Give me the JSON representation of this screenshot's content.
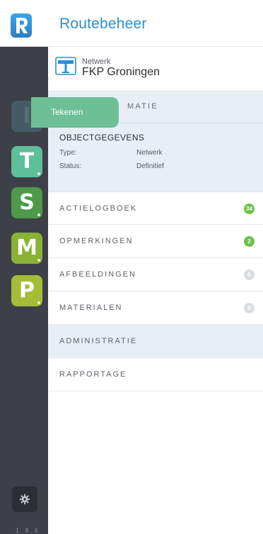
{
  "header": {
    "logo_letter": "R",
    "title": "Routebeheer"
  },
  "rail": {
    "modules": [
      {
        "letter": "I",
        "color": "#4d7482",
        "state": "disabled"
      },
      {
        "letter": "T",
        "color": "#5fbf9a",
        "state": "active"
      },
      {
        "letter": "S",
        "color": "#4e9a48",
        "state": "normal"
      },
      {
        "letter": "M",
        "color": "#8ab236",
        "state": "normal"
      },
      {
        "letter": "P",
        "color": "#a3bd37",
        "state": "normal"
      }
    ],
    "settings_icon": "gear-icon",
    "version": "1.8.6"
  },
  "tooltip": {
    "text": "Tekenen"
  },
  "network": {
    "icon": "signpost-icon",
    "label": "Netwerk",
    "name": "FKP Groningen"
  },
  "sections": {
    "info_header": "MATIE",
    "object": {
      "title": "OBJECTGEGEVENS",
      "fields": [
        {
          "key": "Type:",
          "value": "Netwerk"
        },
        {
          "key": "Status:",
          "value": "Definitief"
        }
      ]
    },
    "rows": [
      {
        "label": "ACTIELOGBOEK",
        "badge": "34",
        "badge_color": "green"
      },
      {
        "label": "OPMERKINGEN",
        "badge": "2",
        "badge_color": "green"
      },
      {
        "label": "AFBEELDINGEN",
        "badge": "0",
        "badge_color": "grey"
      },
      {
        "label": "MATERIALEN",
        "badge": "0",
        "badge_color": "grey"
      }
    ],
    "admin_header": "ADMINISTRATIE",
    "report_row": "RAPPORTAGE"
  },
  "colors": {
    "accent": "#2b8ed6",
    "rail_bg": "#3d4047",
    "section_bg": "#e8eef6",
    "badge_green": "#6cc04a",
    "badge_grey": "#d9dde2"
  }
}
